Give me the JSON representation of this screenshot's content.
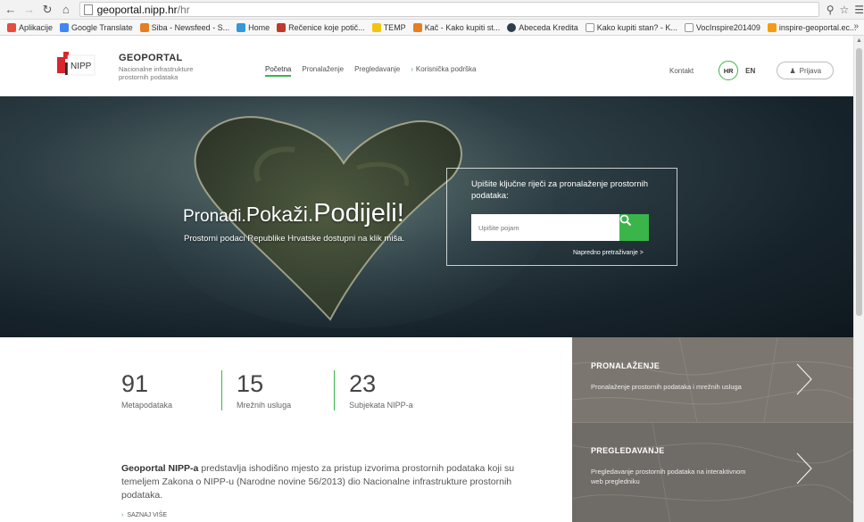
{
  "browser": {
    "url_host": "geoportal.nipp.hr",
    "url_path": "/hr",
    "bookmarks": [
      {
        "label": "Aplikacije",
        "color": "#e74c3c"
      },
      {
        "label": "Google Translate",
        "color": "#4285f4"
      },
      {
        "label": "Siba - Newsfeed - S...",
        "color": "#e67e22"
      },
      {
        "label": "Home",
        "color": "#3498db"
      },
      {
        "label": "Rečenice koje potič...",
        "color": "#c0392b"
      },
      {
        "label": "TEMP",
        "color": "#f1c40f"
      },
      {
        "label": "Kač - Kako kupiti st...",
        "color": "#e67e22"
      },
      {
        "label": "Abeceda Kredita",
        "color": "#2c3e50"
      },
      {
        "label": "Kako kupiti stan? - K...",
        "color": "#bbbbbb"
      },
      {
        "label": "VocInspire201409",
        "color": "#bbbbbb"
      },
      {
        "label": "inspire-geoportal.ec...",
        "color": "#f39c12"
      }
    ]
  },
  "header": {
    "logo_text": "NIPP",
    "title": "GEOPORTAL",
    "subtitle": "Nacionalne infrastrukture prostornih podataka",
    "nav": [
      {
        "label": "Početna",
        "active": true
      },
      {
        "label": "Pronalaženje",
        "active": false
      },
      {
        "label": "Pregledavanje",
        "active": false
      },
      {
        "label": "Korisnička podrška",
        "active": false
      }
    ],
    "kontakt": "Kontakt",
    "lang_hr": "HR",
    "lang_en": "EN",
    "login": "Prijava"
  },
  "hero": {
    "title_w1": "Pronađi.",
    "title_w2": "Pokaži.",
    "title_w3": "Podijeli!",
    "subtitle": "Prostorni podaci Republike Hrvatske dostupni na klik miša.",
    "search_label": "Upišite ključne riječi za pronalaženje prostornih podataka:",
    "search_placeholder": "Upišite pojam",
    "advanced_link": "Napredno pretraživanje >"
  },
  "stats": [
    {
      "value": "91",
      "label": "Metapodataka"
    },
    {
      "value": "15",
      "label": "Mrežnih usluga"
    },
    {
      "value": "23",
      "label": "Subjekata NIPP-a"
    }
  ],
  "description": {
    "bold": "Geoportal NIPP-a",
    "text": " predstavlja ishodišno mjesto za pristup izvorima prostornih podataka koji su temeljem Zakona o NIPP-u (Narodne novine 56/2013) dio Nacionalne infrastrukture prostornih podataka.",
    "more": "SAZNAJ VIŠE"
  },
  "panels": [
    {
      "title": "PRONALAŽENJE",
      "text": "Pronalaženje prostornih podataka i mrežnih usluga"
    },
    {
      "title": "PREGLEDAVANJE",
      "text": "Pregledavanje prostornih podataka na interaktivnom web pregledniku"
    }
  ],
  "colors": {
    "accent": "#39b54a",
    "hero_dark": "#17232b",
    "panel_grey": "#7b7670"
  }
}
